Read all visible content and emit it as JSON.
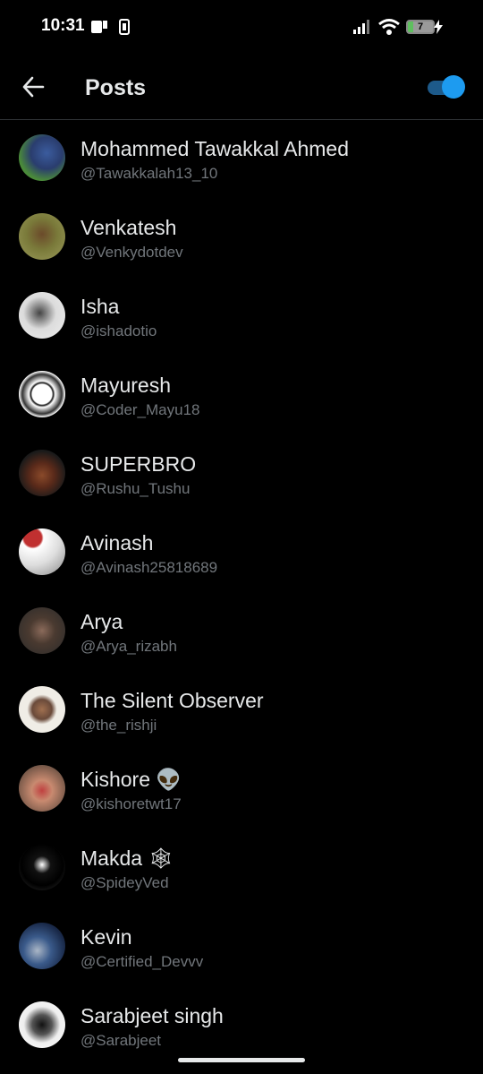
{
  "status": {
    "time": "10:31",
    "battery": "7"
  },
  "header": {
    "title": "Posts"
  },
  "users": [
    {
      "name": "Mohammed Tawakkal Ahmed",
      "handle": "@Tawakkalah13_10"
    },
    {
      "name": "Venkatesh",
      "handle": "@Venkydotdev"
    },
    {
      "name": "Isha",
      "handle": "@ishadotio"
    },
    {
      "name": "Mayuresh",
      "handle": "@Coder_Mayu18"
    },
    {
      "name": "SUPERBRO",
      "handle": "@Rushu_Tushu"
    },
    {
      "name": "Avinash",
      "handle": "@Avinash25818689"
    },
    {
      "name": "Arya",
      "handle": "@Arya_rizabh"
    },
    {
      "name": "The Silent Observer",
      "handle": "@the_rishji"
    },
    {
      "name": "Kishore 👽",
      "handle": "@kishoretwt17"
    },
    {
      "name": "Makda 🕸",
      "handle": "@SpideyVed"
    },
    {
      "name": "Kevin",
      "handle": "@Certified_Devvv"
    },
    {
      "name": "Sarabjeet singh",
      "handle": "@Sarabjeet"
    }
  ]
}
